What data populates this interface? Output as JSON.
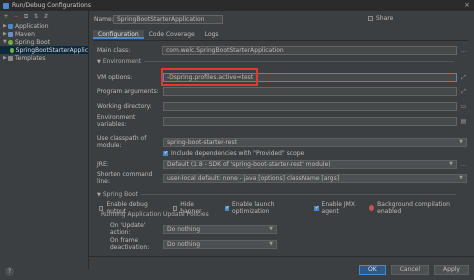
{
  "window": {
    "title": "Run/Debug Configurations",
    "close_glyph": "×"
  },
  "toolbar": {
    "add": "+",
    "remove": "−",
    "copy": "⧉",
    "move": "⇅",
    "sort": "⇵"
  },
  "tree": [
    {
      "label": "Application",
      "indent": 0,
      "arrow": "▶",
      "icon": "app"
    },
    {
      "label": "Maven",
      "indent": 0,
      "arrow": "▶",
      "icon": "mvn"
    },
    {
      "label": "Spring Boot",
      "indent": 0,
      "arrow": "▼",
      "icon": "spring"
    },
    {
      "label": "SpringBootStarterApplic",
      "indent": 1,
      "arrow": "",
      "icon": "spring",
      "selected": true
    },
    {
      "label": "Templates",
      "indent": 0,
      "arrow": "▶",
      "icon": "tmpl"
    }
  ],
  "name": {
    "label": "Name:",
    "value": "SpringBootStarterApplication"
  },
  "share": {
    "label": "Share"
  },
  "tabs": [
    "Configuration",
    "Code Coverage",
    "Logs"
  ],
  "main_class": {
    "label": "Main class:",
    "value": "com.welc.SpringBootStarterApplication"
  },
  "environment": {
    "title": "Environment"
  },
  "vm_options": {
    "label": "VM options:",
    "value": "-Dspring.profiles.active=test"
  },
  "program_arguments": {
    "label": "Program arguments:",
    "value": ""
  },
  "working_directory": {
    "label": "Working directory:",
    "value": ""
  },
  "environment_variables": {
    "label": "Environment variables:",
    "value": ""
  },
  "classpath": {
    "label": "Use classpath of module:",
    "value": "spring-boot-starter-rest"
  },
  "include_provided": {
    "label": "Include dependencies with \"Provided\" scope"
  },
  "jre": {
    "label": "JRE:",
    "value": "Default (1.8 - SDK of 'spring-boot-starter-rest' module)"
  },
  "shorten": {
    "label": "Shorten command line:",
    "value": "user-local default: none - java [options] className [args]"
  },
  "spring_boot": {
    "title": "Spring Boot",
    "debug_output": "Enable debug output",
    "hide_banner": "Hide banner",
    "launch_optimization": "Enable launch optimization",
    "jmx_agent": "Enable JMX agent",
    "background_compilation": "Background compilation enabled",
    "update_policies_title": "Running Application Update Policies",
    "on_update_label": "On 'Update' action:",
    "on_update_value": "Do nothing",
    "on_frame_label": "On frame deactivation:",
    "on_frame_value": "Do nothing"
  },
  "buttons": {
    "ok": "OK",
    "cancel": "Cancel",
    "apply": "Apply",
    "help": "?"
  }
}
